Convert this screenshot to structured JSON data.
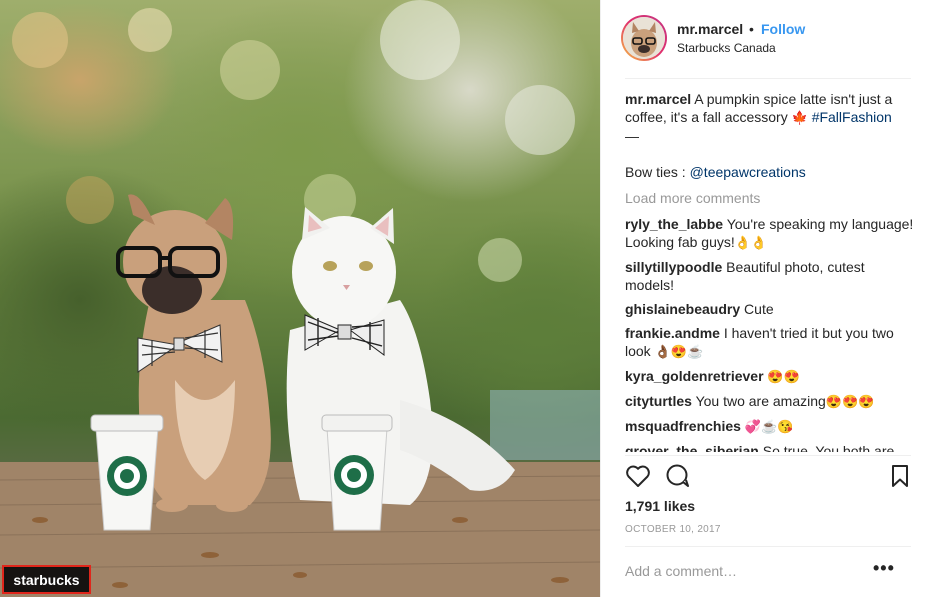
{
  "photo": {
    "tag_label": "starbucks",
    "cup_icon": "starbucks-siren-logo"
  },
  "post": {
    "username": "mr.marcel",
    "separator": "•",
    "follow_label": "Follow",
    "location": "Starbucks Canada"
  },
  "caption": {
    "username": "mr.marcel",
    "text": "A pumpkin spice latte isn't just a coffee, it's a fall accessory",
    "emoji": "🍁",
    "hashtag": "#FallFashion",
    "dash": "—",
    "bowties_label": "Bow ties :",
    "bowties_handle": "@teepawcreations"
  },
  "load_more": "Load more comments",
  "comments": [
    {
      "user": "ryly_the_labbe",
      "text": "You're speaking my language! Looking fab guys!",
      "emoji": "👌👌"
    },
    {
      "user": "sillytillypoodle",
      "text": "Beautiful photo, cutest models!",
      "emoji": ""
    },
    {
      "user": "ghislainebeaudry",
      "text": "Cute",
      "emoji": ""
    },
    {
      "user": "frankie.andme",
      "text": "I haven't tried it but you two look",
      "emoji": "👌🏾😍☕"
    },
    {
      "user": "kyra_goldenretriever",
      "text": "",
      "emoji": "😍😍"
    },
    {
      "user": "cityturtles",
      "text": "You two are amazing",
      "emoji": "😍😍😍"
    },
    {
      "user": "msquadfrenchies",
      "text": "",
      "emoji": "💞☕😘"
    },
    {
      "user": "grover_the_siberian",
      "text": "So true. You both are",
      "emoji": ""
    }
  ],
  "actions": {
    "like_icon": "heart-icon",
    "comment_icon": "comment-icon",
    "save_icon": "bookmark-icon"
  },
  "likes": "1,791 likes",
  "date": "OCTOBER 10, 2017",
  "add_comment_placeholder": "Add a comment…",
  "more_options": "•••",
  "colors": {
    "follow": "#3897f0",
    "hashtag": "#003569",
    "muted": "#999999",
    "tag_border": "#e0261b"
  }
}
